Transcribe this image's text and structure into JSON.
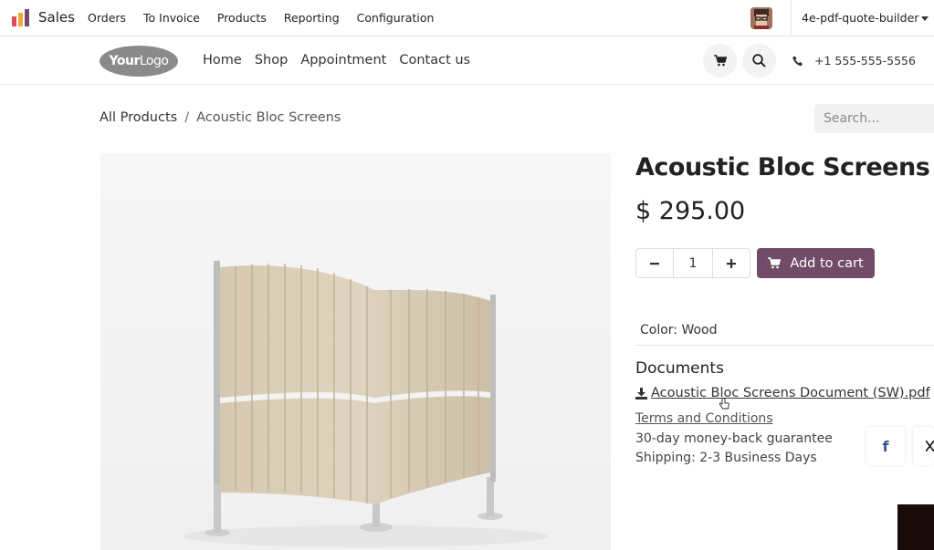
{
  "topbar": {
    "app_name": "Sales",
    "menu": [
      "Orders",
      "To Invoice",
      "Products",
      "Reporting",
      "Configuration"
    ],
    "db_name": "4e-pdf-quote-builder"
  },
  "site": {
    "logo_bold": "Your",
    "logo_light": "Logo",
    "nav": [
      "Home",
      "Shop",
      "Appointment",
      "Contact us"
    ],
    "phone": "+1 555-555-5556"
  },
  "breadcrumb": {
    "root": "All Products",
    "separator": "/",
    "current": "Acoustic Bloc Screens"
  },
  "search": {
    "placeholder": "Search..."
  },
  "product": {
    "title": "Acoustic Bloc Screens",
    "price": "$ 295.00",
    "quantity": "1",
    "add_to_cart": "Add to cart",
    "color_label": "Color: Wood",
    "documents_heading": "Documents",
    "document_link": "Acoustic Bloc Screens Document (SW).pdf",
    "terms": "Terms and Conditions",
    "guarantee": "30-day money-back guarantee",
    "shipping": "Shipping: 2-3 Business Days"
  },
  "colors": {
    "brand": "#714b67",
    "topbar_bg": "#ffffff",
    "image_bg": "#f4f4f4",
    "panel_fabric": "#d8cbb5"
  }
}
